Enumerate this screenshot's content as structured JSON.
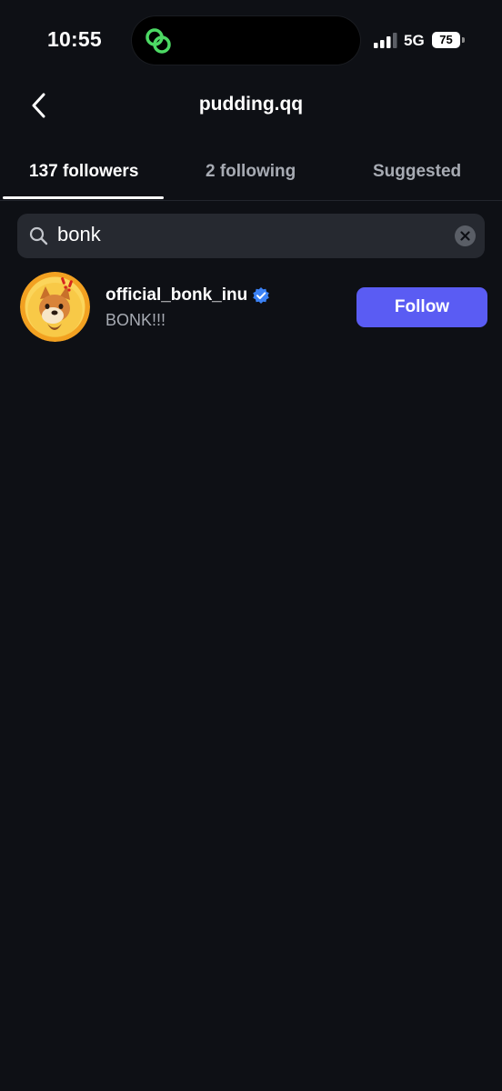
{
  "status_bar": {
    "time": "10:55",
    "network": "5G",
    "battery": "75",
    "island_icon": "link-rings-icon",
    "accent_green": "#4cd964"
  },
  "header": {
    "title": "pudding.qq",
    "back_icon": "chevron-left-icon"
  },
  "tabs": [
    {
      "label": "137 followers",
      "active": true
    },
    {
      "label": "2 following",
      "active": false
    },
    {
      "label": "Suggested",
      "active": false
    }
  ],
  "search": {
    "value": "bonk",
    "icon": "search-icon",
    "clear_icon": "clear-icon"
  },
  "results": [
    {
      "username": "official_bonk_inu",
      "verified": true,
      "bio": "BONK!!!",
      "button_label": "Follow"
    }
  ],
  "colors": {
    "background": "#0e1015",
    "follow_button": "#5a5cf3",
    "verified_badge": "#3b82f6",
    "secondary_text": "#a7abb3"
  }
}
